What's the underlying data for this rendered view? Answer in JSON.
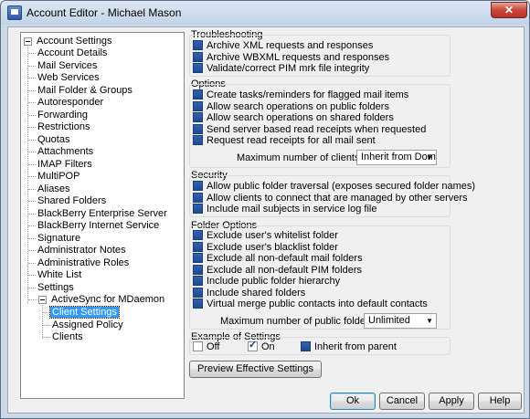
{
  "window": {
    "title": "Account Editor - Michael Mason"
  },
  "tree": {
    "root": "Account Settings",
    "items": [
      "Account Details",
      "Mail Services",
      "Web Services",
      "Mail Folder & Groups",
      "Autoresponder",
      "Forwarding",
      "Restrictions",
      "Quotas",
      "Attachments",
      "IMAP Filters",
      "MultiPOP",
      "Aliases",
      "Shared Folders",
      "BlackBerry Enterprise Server",
      "BlackBerry Internet Service",
      "Signature",
      "Administrator Notes",
      "Administrative Roles",
      "White List",
      "Settings"
    ],
    "activesync": "ActiveSync for MDaemon",
    "activesync_children": [
      "Client Settings",
      "Assigned Policy",
      "Clients"
    ]
  },
  "troubleshooting": {
    "title": "Troubleshooting",
    "options": [
      "Archive XML requests and responses",
      "Archive WBXML requests and responses",
      "Validate/correct PIM mrk file integrity"
    ]
  },
  "options": {
    "title": "Options",
    "items": [
      "Create tasks/reminders for flagged mail items",
      "Allow search operations on public folders",
      "Allow search operations on shared folders",
      "Send server based read receipts when requested",
      "Request read receipts for all mail sent"
    ],
    "max_clients_label": "Maximum number of clients per user",
    "max_clients_value": "Inherit from Domain"
  },
  "security": {
    "title": "Security",
    "items": [
      "Allow public folder traversal (exposes secured folder names)",
      "Allow clients to connect that are managed by other servers",
      "Include mail subjects in service log file"
    ]
  },
  "folder_options": {
    "title": "Folder Options",
    "items": [
      "Exclude user's whitelist folder",
      "Exclude user's blacklist folder",
      "Exclude all non-default mail folders",
      "Exclude all non-default PIM folders",
      "Include public folder hierarchy",
      "Include shared folders",
      "Virtual merge public contacts into default contacts"
    ],
    "max_public_label": "Maximum number of public folders allowed",
    "max_public_value": "Unlimited"
  },
  "example": {
    "title": "Example of Settings",
    "off": "Off",
    "on": "On",
    "inherit": "Inherit from parent"
  },
  "buttons": {
    "preview": "Preview Effective Settings",
    "ok": "Ok",
    "cancel": "Cancel",
    "apply": "Apply",
    "help": "Help"
  },
  "colors": {
    "selection": "#3399ff",
    "checkbox_fill": "#1e4a95"
  }
}
